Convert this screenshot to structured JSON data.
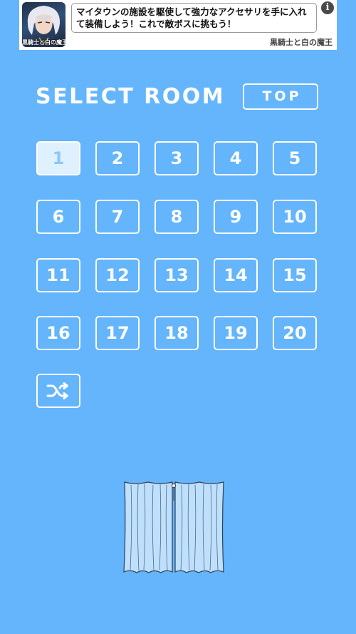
{
  "ad": {
    "icon_caption": "黒騎士と白の魔王",
    "text": "マイタウンの施設を駆使して強力なアクセサリを手に入れて装備しよう！これで敵ボスに挑もう！",
    "info_label": "i",
    "advertiser": "黒騎士と白の魔王"
  },
  "header": {
    "title": "SELECT ROOM",
    "top_button_label": "TOP"
  },
  "rooms": {
    "selected": 1,
    "labels": [
      "1",
      "2",
      "3",
      "4",
      "5",
      "6",
      "7",
      "8",
      "9",
      "10",
      "11",
      "12",
      "13",
      "14",
      "15",
      "16",
      "17",
      "18",
      "19",
      "20"
    ]
  },
  "shuffle": {
    "icon": "shuffle-icon"
  },
  "curtain": {
    "icon": "curtain",
    "color": "#bfe0fc"
  },
  "colors": {
    "background": "#64b5fc",
    "button_border": "#ffffff",
    "selected_fill": "#dff0fe",
    "selected_text": "#8cc8f8"
  }
}
